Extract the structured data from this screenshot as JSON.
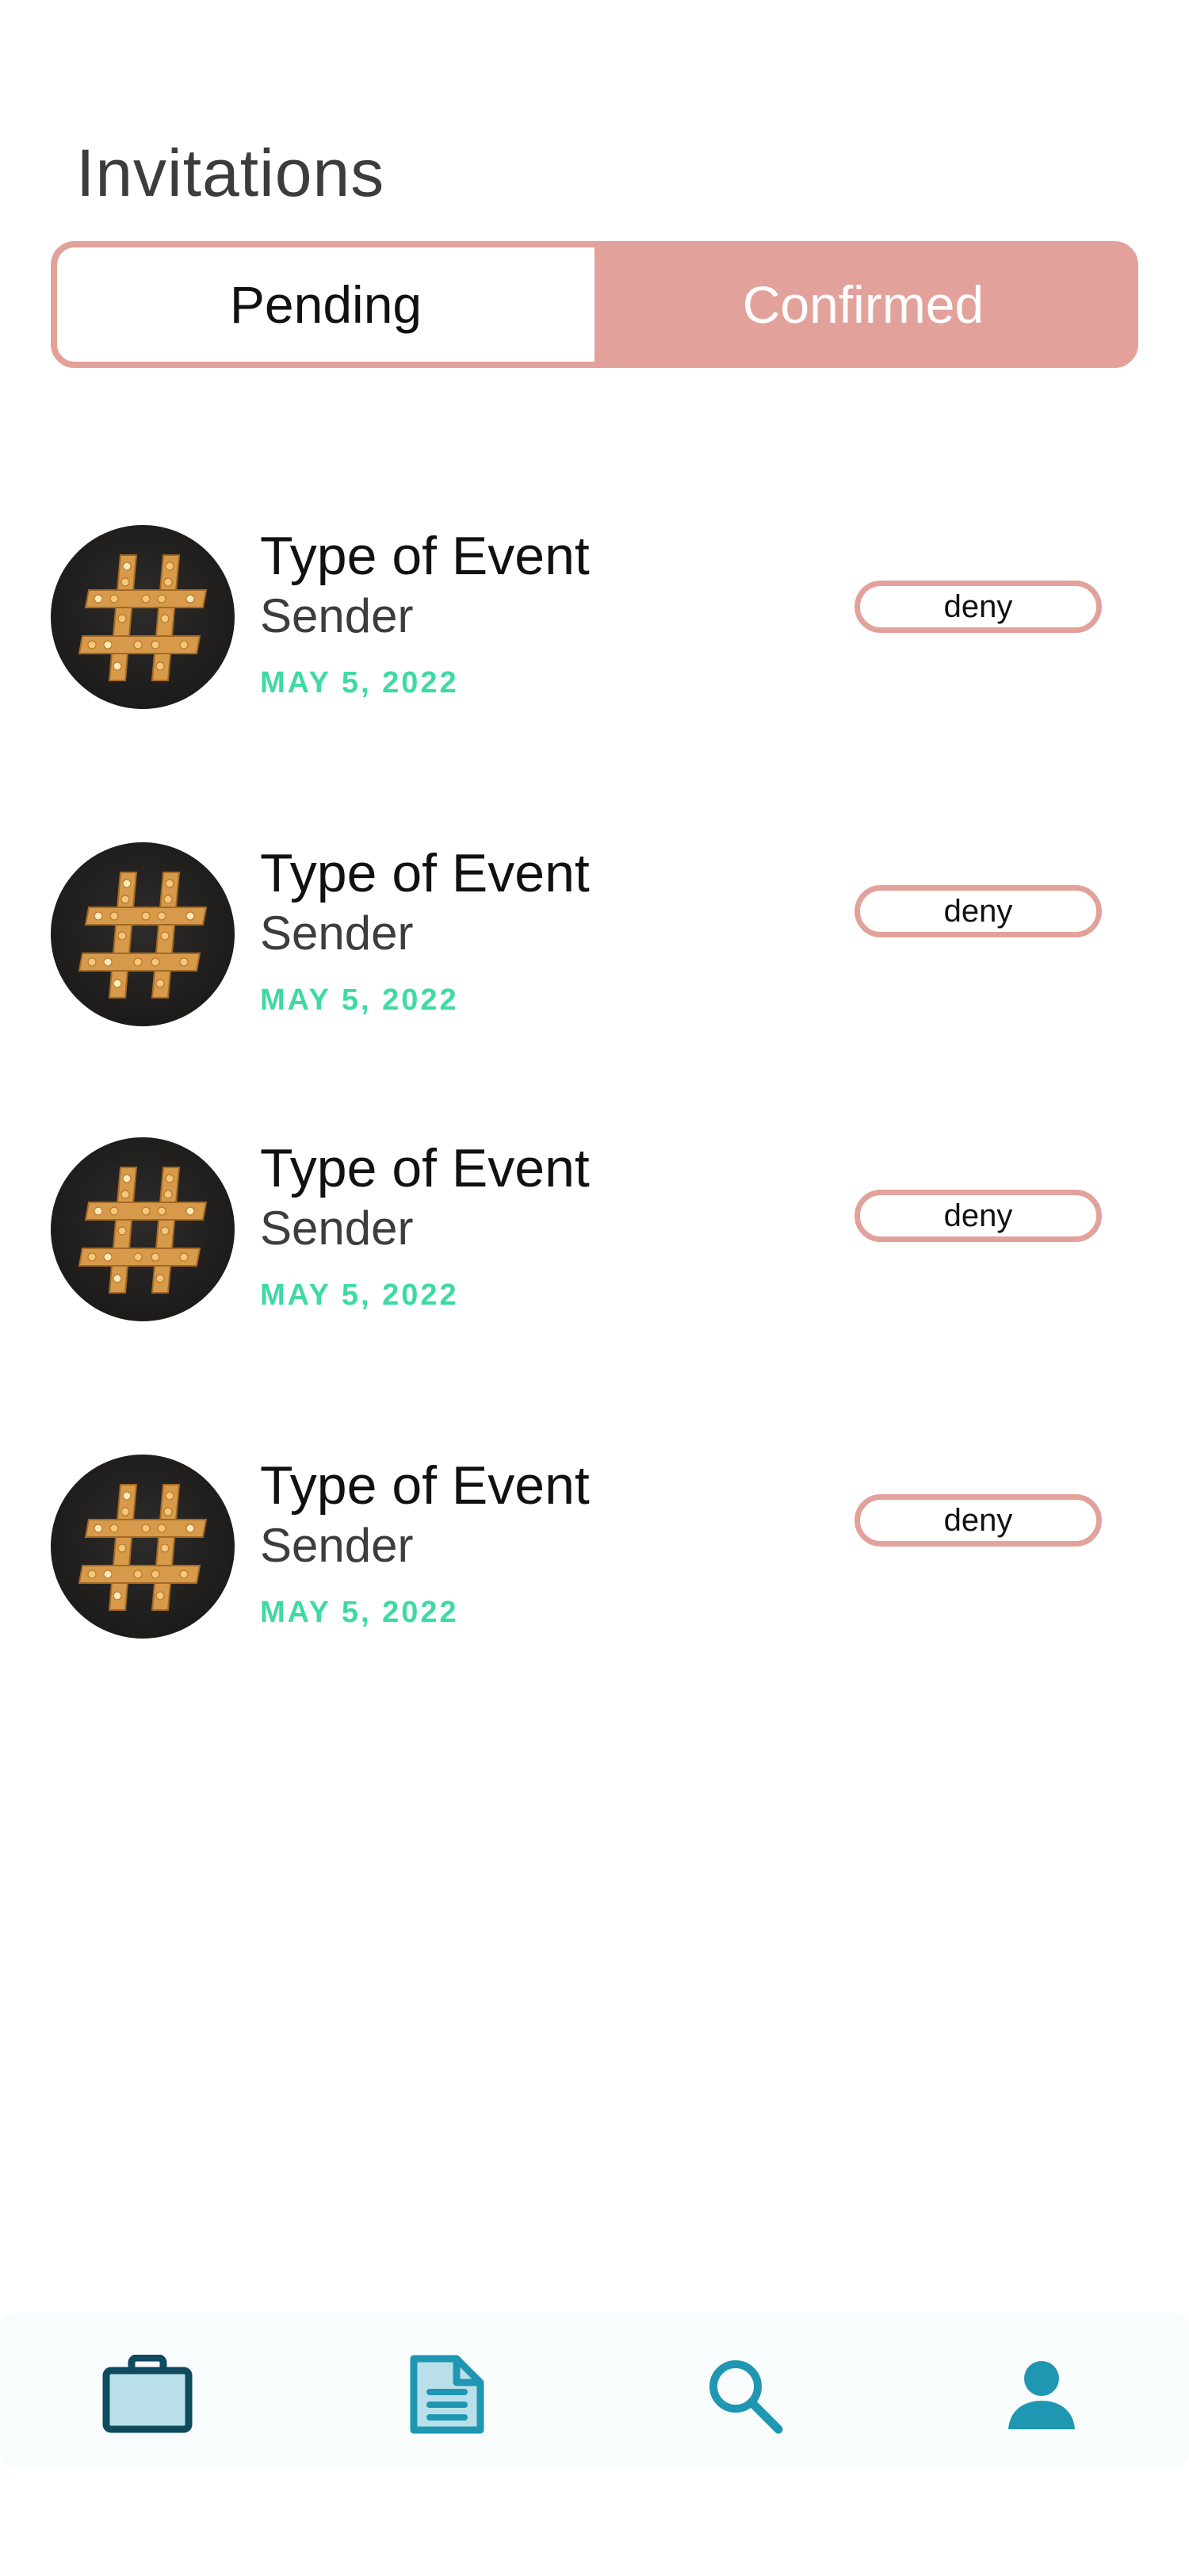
{
  "header": {
    "title": "Invitations"
  },
  "tabs": [
    {
      "label": "Pending",
      "active": false
    },
    {
      "label": "Confirmed",
      "active": true
    }
  ],
  "invitations": [
    {
      "type": "Type of Event",
      "sender": "Sender",
      "date": "MAY 5, 2022",
      "deny_label": "deny",
      "avatar_icon": "hashtag-marquee-icon"
    },
    {
      "type": "Type of Event",
      "sender": "Sender",
      "date": "MAY 5, 2022",
      "deny_label": "deny",
      "avatar_icon": "hashtag-marquee-icon"
    },
    {
      "type": "Type of Event",
      "sender": "Sender",
      "date": "MAY 5, 2022",
      "deny_label": "deny",
      "avatar_icon": "hashtag-marquee-icon"
    },
    {
      "type": "Type of Event",
      "sender": "Sender",
      "date": "MAY 5, 2022",
      "deny_label": "deny",
      "avatar_icon": "hashtag-marquee-icon"
    }
  ],
  "bottom_nav": [
    {
      "icon": "briefcase-icon",
      "active": true
    },
    {
      "icon": "document-icon",
      "active": false
    },
    {
      "icon": "search-icon",
      "active": false
    },
    {
      "icon": "profile-icon",
      "active": false
    }
  ],
  "colors": {
    "accent": "#e2a29b",
    "date_green": "#3fdaa4",
    "nav_teal": "#1f97b3",
    "nav_dark": "#0f4a5e"
  }
}
